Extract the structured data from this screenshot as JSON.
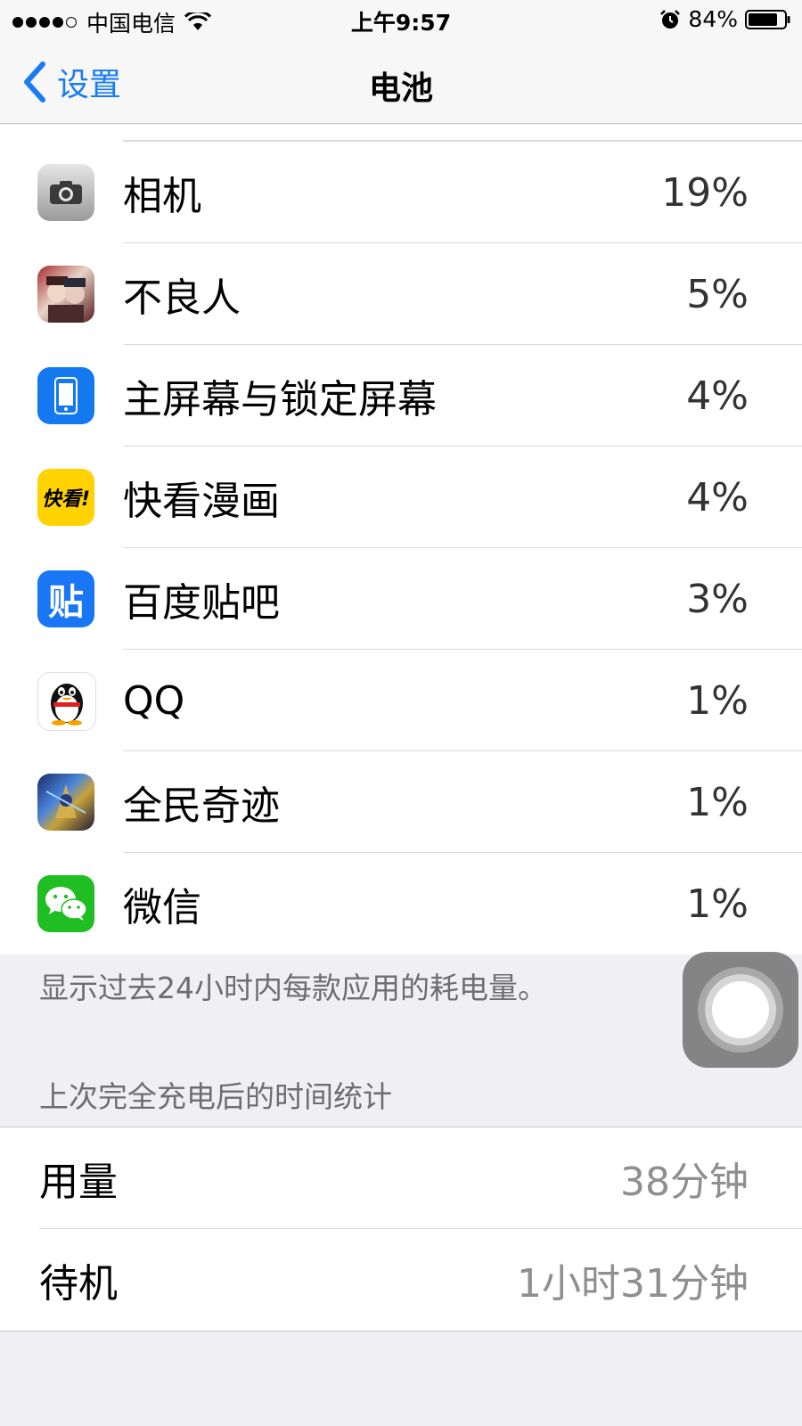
{
  "status_bar": {
    "carrier": "中国电信",
    "time": "上午9:57",
    "battery_percent": "84%",
    "signal_bars_filled": 4,
    "signal_bars_total": 5,
    "icons": [
      "wifi-icon",
      "alarm-icon",
      "battery-icon"
    ]
  },
  "nav": {
    "back_label": "设置",
    "title": "电池"
  },
  "apps": [
    {
      "name": "相机",
      "percent": "19%",
      "icon": "camera-app-icon"
    },
    {
      "name": "不良人",
      "percent": "5%",
      "icon": "buliangren-app-icon"
    },
    {
      "name": "主屏幕与锁定屏幕",
      "percent": "4%",
      "icon": "home-lock-screen-icon"
    },
    {
      "name": "快看漫画",
      "percent": "4%",
      "icon": "kuaikan-app-icon",
      "icon_text": "快看!"
    },
    {
      "name": "百度贴吧",
      "percent": "3%",
      "icon": "tieba-app-icon",
      "icon_text": "贴"
    },
    {
      "name": "QQ",
      "percent": "1%",
      "icon": "qq-app-icon"
    },
    {
      "name": "全民奇迹",
      "percent": "1%",
      "icon": "quanminqiji-app-icon"
    },
    {
      "name": "微信",
      "percent": "1%",
      "icon": "wechat-app-icon"
    }
  ],
  "footnote": "显示过去24小时内每款应用的耗电量。",
  "since_charge": {
    "header": "上次完全充电后的时间统计",
    "usage_label": "用量",
    "usage_value": "38分钟",
    "standby_label": "待机",
    "standby_value": "1小时31分钟"
  },
  "colors": {
    "accent": "#1a7cf5",
    "background": "#efeff4",
    "secondary_text": "#6d6d72",
    "value_text": "#8e8e93"
  }
}
